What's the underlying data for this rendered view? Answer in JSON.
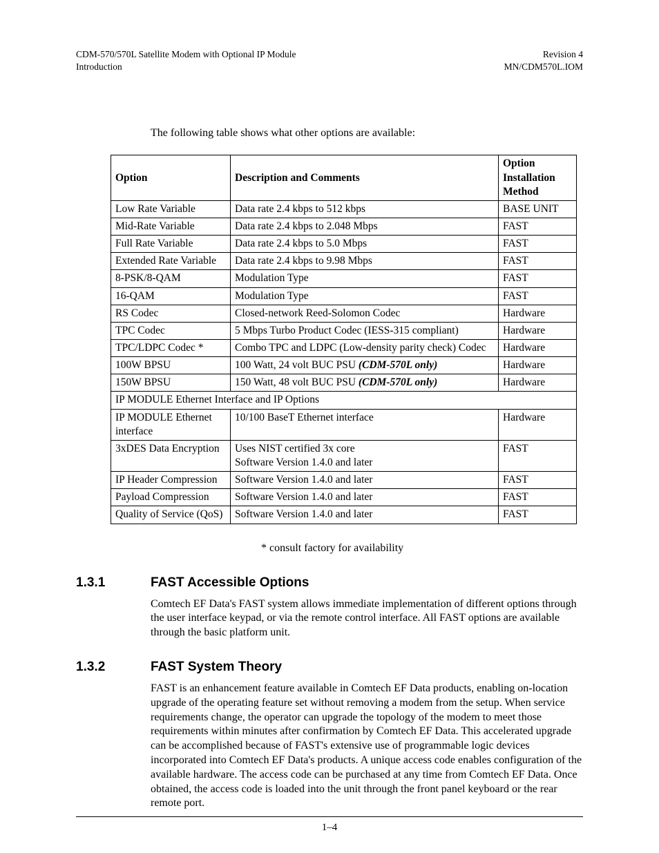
{
  "header": {
    "left_line1": "CDM-570/570L Satellite Modem with Optional IP Module",
    "left_line2": "Introduction",
    "right_line1": "Revision 4",
    "right_line2": "MN/CDM570L.IOM"
  },
  "intro": "The following table shows what other options are available:",
  "table": {
    "headers": {
      "option": "Option",
      "desc": "Description and Comments",
      "method": "Option Installation Method"
    },
    "rows": [
      {
        "option": "Low Rate Variable",
        "desc": "Data rate 2.4 kbps to 512 kbps",
        "method": "BASE UNIT"
      },
      {
        "option": "Mid-Rate Variable",
        "desc": "Data rate 2.4 kbps to 2.048 Mbps",
        "method": "FAST"
      },
      {
        "option": "Full Rate Variable",
        "desc": "Data rate 2.4 kbps to 5.0 Mbps",
        "method": "FAST"
      },
      {
        "option": "Extended Rate Variable",
        "desc": "Data rate 2.4 kbps to 9.98 Mbps",
        "method": "FAST"
      },
      {
        "option": "8-PSK/8-QAM",
        "desc": "Modulation Type",
        "method": "FAST"
      },
      {
        "option": "16-QAM",
        "desc": "Modulation Type",
        "method": "FAST"
      },
      {
        "option": "RS Codec",
        "desc": "Closed-network Reed-Solomon Codec",
        "method": "Hardware"
      },
      {
        "option": "TPC Codec",
        "desc": "5 Mbps Turbo Product Codec (IESS-315 compliant)",
        "method": "Hardware"
      },
      {
        "option": "TPC/LDPC Codec *",
        "desc": "Combo TPC and LDPC (Low-density parity check) Codec",
        "method": "Hardware"
      },
      {
        "option": "100W BPSU",
        "desc_pre": "100 Watt, 24 volt BUC PSU ",
        "desc_em": "(CDM-570L only)",
        "method": "Hardware"
      },
      {
        "option": "150W BPSU",
        "desc_pre": "150 Watt, 48 volt BUC PSU ",
        "desc_em": "(CDM-570L only)",
        "method": "Hardware"
      }
    ],
    "span_row": "IP MODULE Ethernet Interface and IP Options",
    "rows2": [
      {
        "option": "IP MODULE Ethernet interface",
        "desc": "10/100 BaseT Ethernet interface",
        "method": "Hardware"
      },
      {
        "option": "3xDES Data Encryption",
        "desc_line1": "Uses NIST certified 3x core",
        "desc_line2": "Software Version 1.4.0 and later",
        "method": "FAST"
      },
      {
        "option": "IP Header Compression",
        "desc": "Software Version 1.4.0 and later",
        "method": "FAST"
      },
      {
        "option": "Payload Compression",
        "desc": "Software Version 1.4.0 and later",
        "method": "FAST"
      },
      {
        "option": "Quality of Service (QoS)",
        "desc": "Software Version 1.4.0 and later",
        "method": "FAST"
      }
    ]
  },
  "footnote": "* consult factory for availability",
  "section1": {
    "num": "1.3.1",
    "title": "FAST Accessible Options",
    "para": "Comtech EF Data's FAST system allows immediate implementation of different options through the user interface keypad, or via the remote control interface. All FAST options are available through the basic platform unit."
  },
  "section2": {
    "num": "1.3.2",
    "title": "FAST System Theory",
    "para": "FAST is an enhancement feature available in Comtech EF Data products, enabling on-location upgrade of the operating feature set without removing a modem from the setup. When service requirements change, the operator can upgrade the topology of the modem to meet those requirements within minutes after confirmation by Comtech EF Data. This accelerated upgrade can be accomplished because of FAST's extensive use of programmable logic devices incorporated into Comtech EF Data's products. A unique access code enables configuration of the available hardware. The access code can be purchased at any time from Comtech EF Data. Once obtained, the access code is loaded into the unit through the front panel keyboard or the rear remote port."
  },
  "pagenum": "1–4"
}
